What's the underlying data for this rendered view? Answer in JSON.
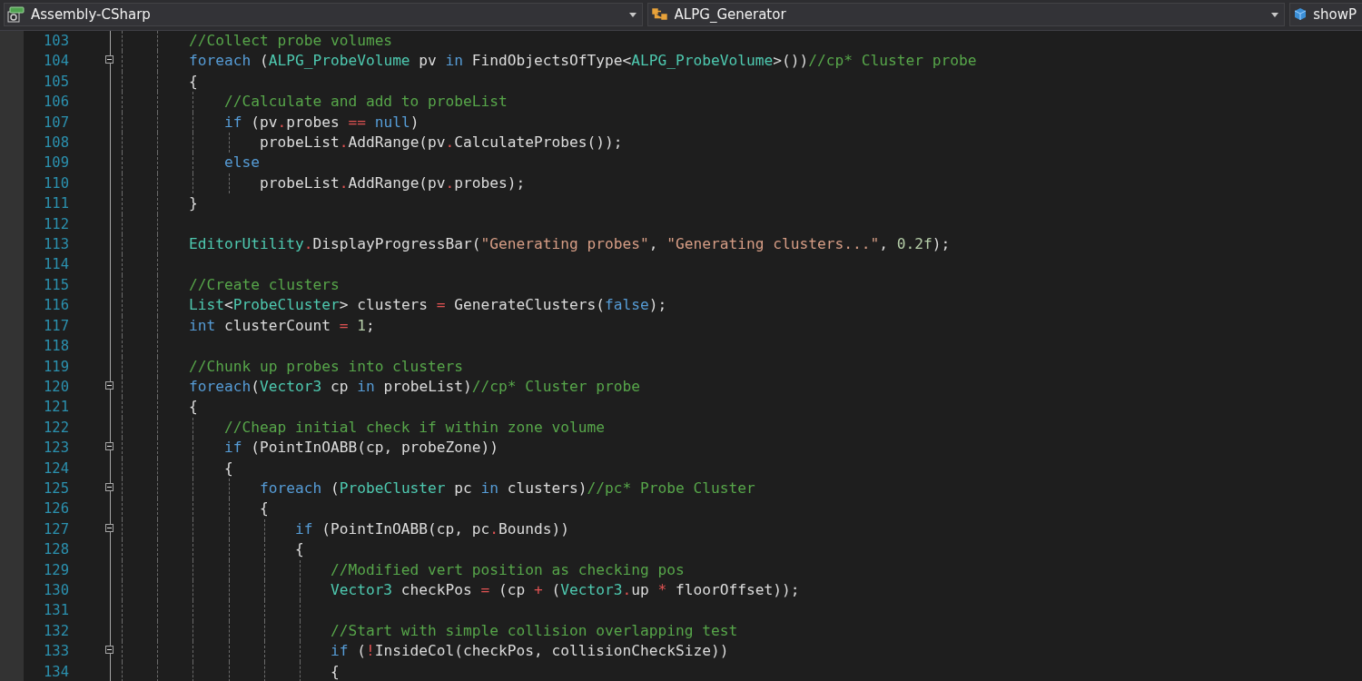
{
  "navigation_bar": [
    {
      "kind": "project",
      "label": "Assembly-CSharp"
    },
    {
      "kind": "type",
      "label": "ALPG_Generator"
    },
    {
      "kind": "member",
      "label": "showP"
    }
  ],
  "editor": {
    "lines": [
      {
        "number": "103",
        "foldable": false,
        "tokens": [
          {
            "kind": "comment",
            "text": "        //Collect probe volumes"
          }
        ]
      },
      {
        "number": "104",
        "foldable": true,
        "tokens": [
          {
            "kind": "keyword",
            "text": "        foreach"
          },
          {
            "kind": "plain",
            "text": " ("
          },
          {
            "kind": "type",
            "text": "ALPG_ProbeVolume"
          },
          {
            "kind": "plain",
            "text": " pv "
          },
          {
            "kind": "keyword",
            "text": "in"
          },
          {
            "kind": "plain",
            "text": " FindObjectsOfType<"
          },
          {
            "kind": "type",
            "text": "ALPG_ProbeVolume"
          },
          {
            "kind": "plain",
            "text": ">())"
          },
          {
            "kind": "comment",
            "text": "//cp* Cluster probe"
          }
        ]
      },
      {
        "number": "105",
        "foldable": false,
        "tokens": [
          {
            "kind": "plain",
            "text": "        {"
          }
        ]
      },
      {
        "number": "106",
        "foldable": false,
        "tokens": [
          {
            "kind": "comment",
            "text": "            //Calculate and add to probeList"
          }
        ]
      },
      {
        "number": "107",
        "foldable": false,
        "tokens": [
          {
            "kind": "keyword",
            "text": "            if"
          },
          {
            "kind": "plain",
            "text": " (pv"
          },
          {
            "kind": "operator",
            "text": "."
          },
          {
            "kind": "plain",
            "text": "probes "
          },
          {
            "kind": "operator",
            "text": "=="
          },
          {
            "kind": "keyword",
            "text": " null"
          },
          {
            "kind": "plain",
            "text": ")"
          }
        ]
      },
      {
        "number": "108",
        "foldable": false,
        "tokens": [
          {
            "kind": "plain",
            "text": "                probeList"
          },
          {
            "kind": "operator",
            "text": "."
          },
          {
            "kind": "plain",
            "text": "AddRange(pv"
          },
          {
            "kind": "operator",
            "text": "."
          },
          {
            "kind": "plain",
            "text": "CalculateProbes());"
          }
        ]
      },
      {
        "number": "109",
        "foldable": false,
        "tokens": [
          {
            "kind": "keyword",
            "text": "            else"
          }
        ]
      },
      {
        "number": "110",
        "foldable": false,
        "tokens": [
          {
            "kind": "plain",
            "text": "                probeList"
          },
          {
            "kind": "operator",
            "text": "."
          },
          {
            "kind": "plain",
            "text": "AddRange(pv"
          },
          {
            "kind": "operator",
            "text": "."
          },
          {
            "kind": "plain",
            "text": "probes);"
          }
        ]
      },
      {
        "number": "111",
        "foldable": false,
        "tokens": [
          {
            "kind": "plain",
            "text": "        }"
          }
        ]
      },
      {
        "number": "112",
        "foldable": false
      },
      {
        "number": "113",
        "foldable": false,
        "tokens": [
          {
            "kind": "type",
            "text": "        EditorUtility"
          },
          {
            "kind": "operator",
            "text": "."
          },
          {
            "kind": "plain",
            "text": "DisplayProgressBar("
          },
          {
            "kind": "string",
            "text": "\"Generating probes\""
          },
          {
            "kind": "plain",
            "text": ", "
          },
          {
            "kind": "string",
            "text": "\"Generating clusters...\""
          },
          {
            "kind": "plain",
            "text": ", "
          },
          {
            "kind": "number",
            "text": "0.2f"
          },
          {
            "kind": "plain",
            "text": ");"
          }
        ]
      },
      {
        "number": "114",
        "foldable": false
      },
      {
        "number": "115",
        "foldable": false,
        "tokens": [
          {
            "kind": "comment",
            "text": "        //Create clusters"
          }
        ]
      },
      {
        "number": "116",
        "foldable": false,
        "tokens": [
          {
            "kind": "type",
            "text": "        List"
          },
          {
            "kind": "plain",
            "text": "<"
          },
          {
            "kind": "type",
            "text": "ProbeCluster"
          },
          {
            "kind": "plain",
            "text": "> clusters "
          },
          {
            "kind": "operator",
            "text": "="
          },
          {
            "kind": "plain",
            "text": " GenerateClusters("
          },
          {
            "kind": "keyword",
            "text": "false"
          },
          {
            "kind": "plain",
            "text": ");"
          }
        ]
      },
      {
        "number": "117",
        "foldable": false,
        "tokens": [
          {
            "kind": "keyword",
            "text": "        int"
          },
          {
            "kind": "plain",
            "text": " clusterCount "
          },
          {
            "kind": "operator",
            "text": "="
          },
          {
            "kind": "number",
            "text": " 1"
          },
          {
            "kind": "plain",
            "text": ";"
          }
        ]
      },
      {
        "number": "118",
        "foldable": false
      },
      {
        "number": "119",
        "foldable": false,
        "tokens": [
          {
            "kind": "comment",
            "text": "        //Chunk up probes into clusters"
          }
        ]
      },
      {
        "number": "120",
        "foldable": true,
        "tokens": [
          {
            "kind": "keyword",
            "text": "        foreach"
          },
          {
            "kind": "plain",
            "text": "("
          },
          {
            "kind": "type",
            "text": "Vector3"
          },
          {
            "kind": "plain",
            "text": " cp "
          },
          {
            "kind": "keyword",
            "text": "in"
          },
          {
            "kind": "plain",
            "text": " probeList)"
          },
          {
            "kind": "comment",
            "text": "//cp* Cluster probe"
          }
        ]
      },
      {
        "number": "121",
        "foldable": false,
        "tokens": [
          {
            "kind": "plain",
            "text": "        {"
          }
        ]
      },
      {
        "number": "122",
        "foldable": false,
        "tokens": [
          {
            "kind": "comment",
            "text": "            //Cheap initial check if within zone volume"
          }
        ]
      },
      {
        "number": "123",
        "foldable": true,
        "tokens": [
          {
            "kind": "keyword",
            "text": "            if"
          },
          {
            "kind": "plain",
            "text": " (PointInOABB(cp, probeZone))"
          }
        ]
      },
      {
        "number": "124",
        "foldable": false,
        "tokens": [
          {
            "kind": "plain",
            "text": "            {"
          }
        ]
      },
      {
        "number": "125",
        "foldable": true,
        "tokens": [
          {
            "kind": "keyword",
            "text": "                foreach"
          },
          {
            "kind": "plain",
            "text": " ("
          },
          {
            "kind": "type",
            "text": "ProbeCluster"
          },
          {
            "kind": "plain",
            "text": " pc "
          },
          {
            "kind": "keyword",
            "text": "in"
          },
          {
            "kind": "plain",
            "text": " clusters)"
          },
          {
            "kind": "comment",
            "text": "//pc* Probe Cluster"
          }
        ]
      },
      {
        "number": "126",
        "foldable": false,
        "tokens": [
          {
            "kind": "plain",
            "text": "                {"
          }
        ]
      },
      {
        "number": "127",
        "foldable": true,
        "tokens": [
          {
            "kind": "keyword",
            "text": "                    if"
          },
          {
            "kind": "plain",
            "text": " (PointInOABB(cp, pc"
          },
          {
            "kind": "operator",
            "text": "."
          },
          {
            "kind": "plain",
            "text": "Bounds))"
          }
        ]
      },
      {
        "number": "128",
        "foldable": false,
        "tokens": [
          {
            "kind": "plain",
            "text": "                    {"
          }
        ]
      },
      {
        "number": "129",
        "foldable": false,
        "tokens": [
          {
            "kind": "comment",
            "text": "                        //Modified vert position as checking pos"
          }
        ]
      },
      {
        "number": "130",
        "foldable": false,
        "tokens": [
          {
            "kind": "type",
            "text": "                        Vector3"
          },
          {
            "kind": "plain",
            "text": " checkPos "
          },
          {
            "kind": "operator",
            "text": "="
          },
          {
            "kind": "plain",
            "text": " (cp "
          },
          {
            "kind": "operator",
            "text": "+"
          },
          {
            "kind": "plain",
            "text": " ("
          },
          {
            "kind": "type",
            "text": "Vector3"
          },
          {
            "kind": "operator",
            "text": "."
          },
          {
            "kind": "plain",
            "text": "up "
          },
          {
            "kind": "operator",
            "text": "*"
          },
          {
            "kind": "plain",
            "text": " floorOffset));"
          }
        ]
      },
      {
        "number": "131",
        "foldable": false
      },
      {
        "number": "132",
        "foldable": false,
        "tokens": [
          {
            "kind": "comment",
            "text": "                        //Start with simple collision overlapping test"
          }
        ]
      },
      {
        "number": "133",
        "foldable": true,
        "tokens": [
          {
            "kind": "keyword",
            "text": "                        if"
          },
          {
            "kind": "plain",
            "text": " ("
          },
          {
            "kind": "operator",
            "text": "!"
          },
          {
            "kind": "plain",
            "text": "InsideCol(checkPos, collisionCheckSize))"
          }
        ]
      },
      {
        "number": "134",
        "foldable": false,
        "tokens": [
          {
            "kind": "plain",
            "text": "                        {"
          }
        ]
      }
    ]
  }
}
